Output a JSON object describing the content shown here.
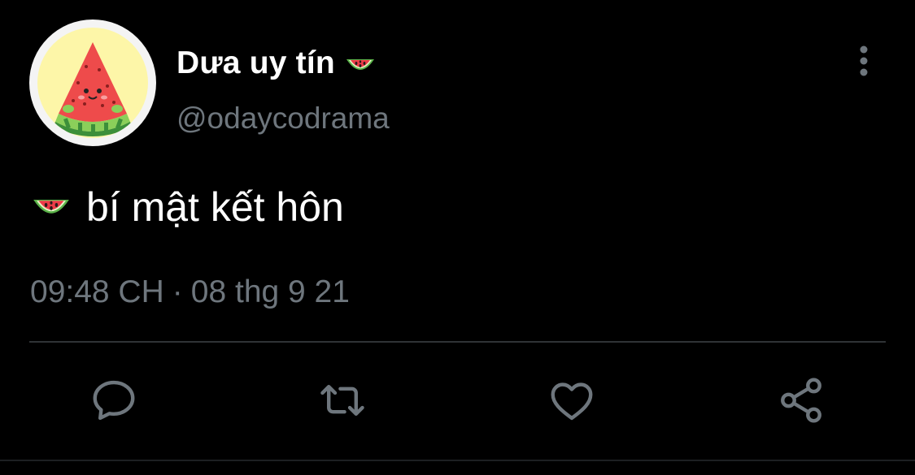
{
  "author": {
    "display_name": "Dưa uy tín",
    "name_emoji": "watermelon-emoji",
    "handle": "@odaycodrama",
    "avatar": "watermelon-slice-avatar"
  },
  "menu": {
    "icon": "more-vertical-icon"
  },
  "tweet": {
    "emoji": "watermelon-emoji",
    "text": "bí mật kết hôn",
    "time": "09:48 CH",
    "separator": "·",
    "date": "08 thg 9 21"
  },
  "actions": [
    {
      "icon": "reply-icon"
    },
    {
      "icon": "retweet-icon"
    },
    {
      "icon": "like-icon"
    },
    {
      "icon": "share-icon"
    }
  ],
  "colors": {
    "background": "#000000",
    "primary_text": "#ffffff",
    "secondary_text": "#6e767d",
    "divider": "#2f3336",
    "avatar_bg": "#fdf6a8"
  }
}
